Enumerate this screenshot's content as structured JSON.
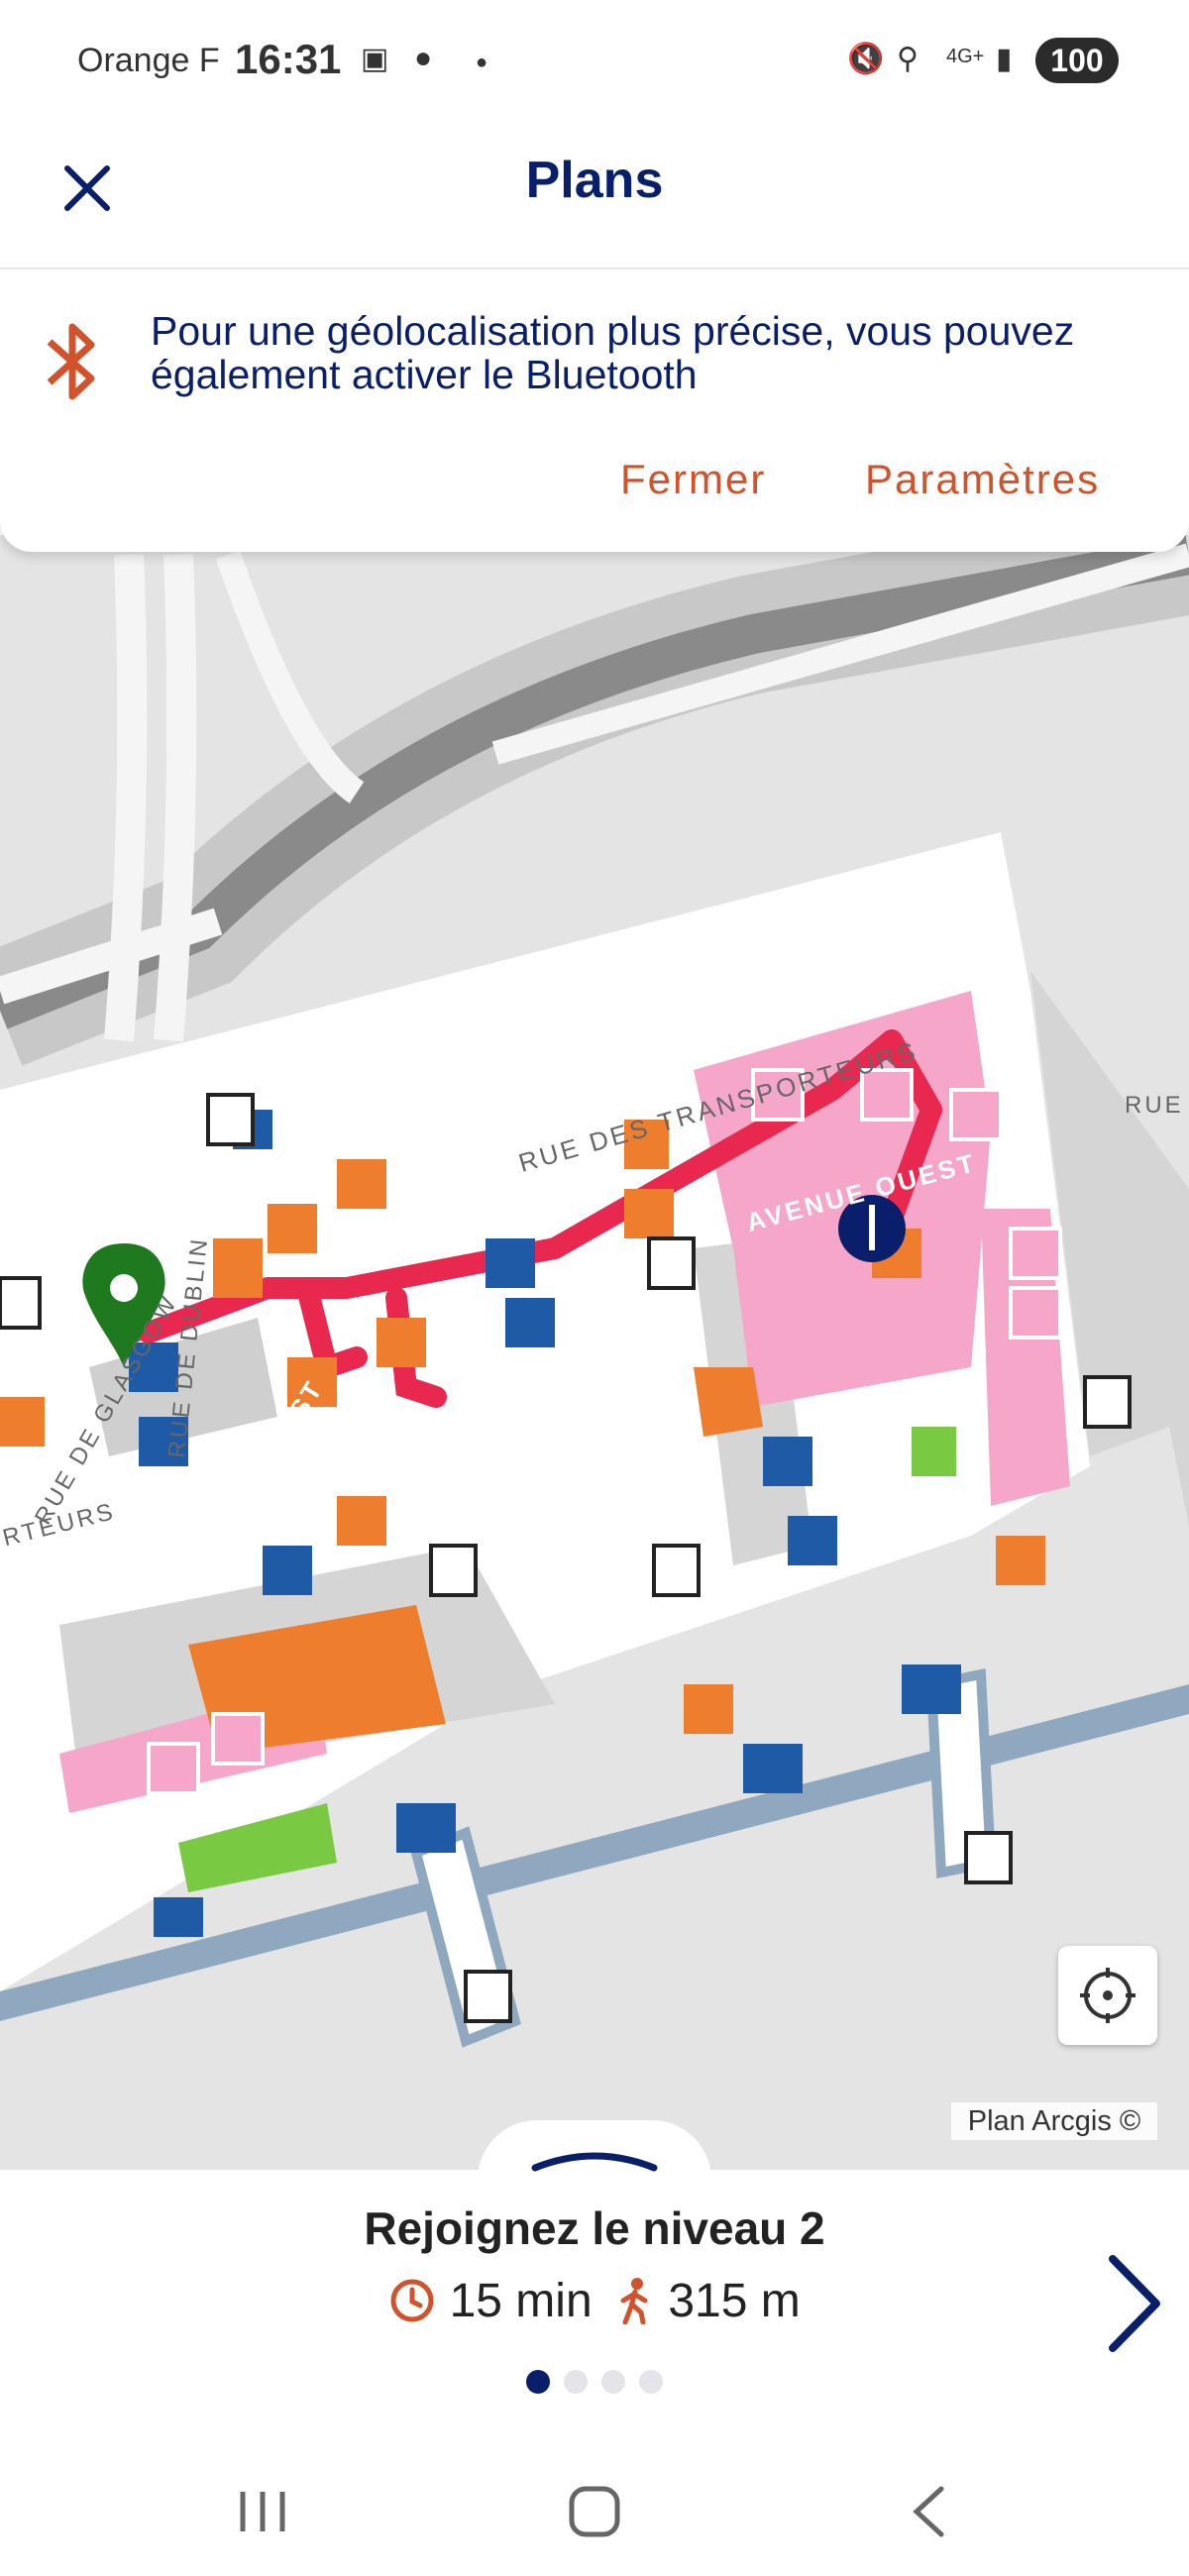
{
  "status_bar": {
    "carrier": "Orange F",
    "time": "16:31",
    "network": "4G+",
    "battery": "100"
  },
  "header": {
    "title": "Plans",
    "close_icon": "close-icon"
  },
  "banner": {
    "icon": "bluetooth-icon",
    "message": "Pour une géolocalisation plus précise, vous pouvez également activer le Bluetooth",
    "dismiss_label": "Fermer",
    "settings_label": "Paramètres"
  },
  "map": {
    "street_labels": [
      "RUE DES TRANSPORTEURS",
      "AVENUE OUEST",
      "AVENUE OUEST",
      "RUE DE GLASGOW",
      "RUE DE DUBLIN",
      "RTEURS",
      "RUE"
    ],
    "attribution": "Plan Arcgis ©",
    "colors": {
      "route": "#e8284f",
      "shops": "#f6a6c8",
      "services": "#ee7d2d",
      "info": "#1e5aa6",
      "destination_pin": "#1f7a1f"
    }
  },
  "bottom_sheet": {
    "step_title": "Rejoignez le niveau 2",
    "duration": "15 min",
    "distance": "315 m",
    "page_count": 4,
    "active_page": 1
  },
  "nav_bar": {
    "items": [
      "recent-apps",
      "home",
      "back"
    ]
  }
}
